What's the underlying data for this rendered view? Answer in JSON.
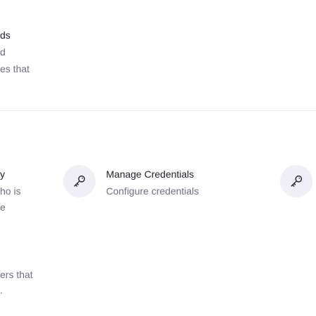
{
  "top_card": {
    "title": "ds",
    "desc_line1": "d",
    "desc_line2": "es that"
  },
  "middle_left_card": {
    "title": "y",
    "desc_line1": "ho is",
    "desc_line2": "e"
  },
  "manage_credentials": {
    "icon": "key-icon",
    "title": "Manage Credentials",
    "description": "Configure credentials"
  },
  "right_card": {
    "icon": "key-icon"
  },
  "bottom_left_card": {
    "desc_line1": "ers that",
    "desc_line2": "."
  },
  "colors": {
    "title": "#1f1f28",
    "description": "#6f6f86",
    "icon_bg": "#efeff5",
    "divider": "#e8e8ef"
  }
}
